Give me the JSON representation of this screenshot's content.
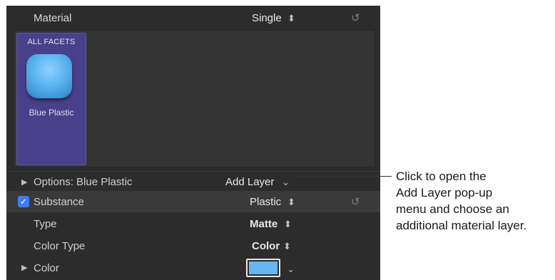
{
  "header": {
    "title": "Material",
    "mode_value": "Single"
  },
  "facet": {
    "title": "ALL FACETS",
    "name": "Blue Plastic"
  },
  "options": {
    "label": "Options: Blue Plastic",
    "add_layer_label": "Add Layer"
  },
  "rows": {
    "substance": {
      "label": "Substance",
      "value": "Plastic",
      "checked": true
    },
    "type": {
      "label": "Type",
      "value": "Matte"
    },
    "color_type": {
      "label": "Color Type",
      "value": "Color"
    },
    "color": {
      "label": "Color",
      "swatch_color": "#67b6f3"
    }
  },
  "callout": {
    "lines": [
      "Click to open the",
      "Add Layer pop-up",
      "menu and choose an",
      "additional material layer."
    ]
  },
  "colors": {
    "panel_bg": "#2c2c2c",
    "facet_tile": "#48408a",
    "checkbox": "#3d7cf2"
  }
}
